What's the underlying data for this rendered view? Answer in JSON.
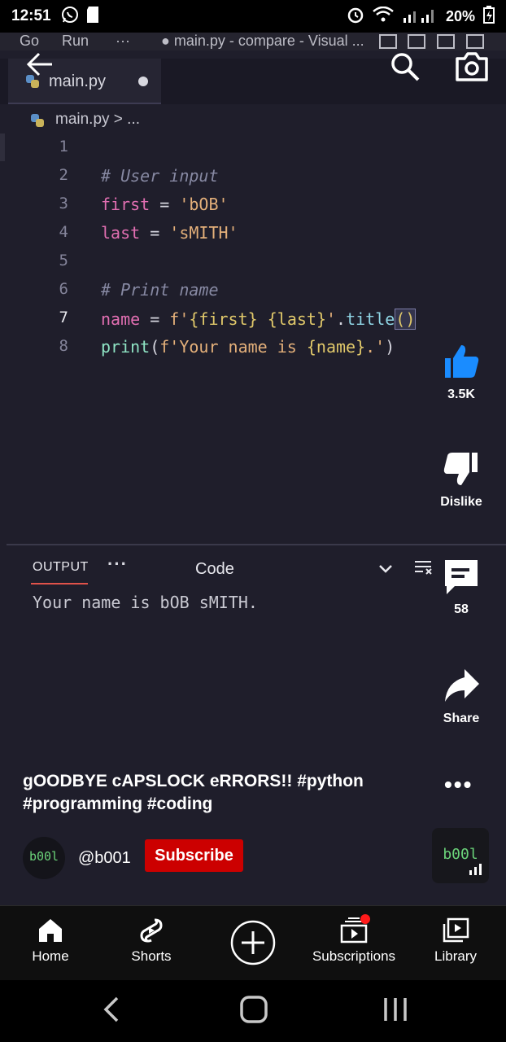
{
  "status_bar": {
    "time": "12:51",
    "battery": "20%",
    "icons": [
      "whatsapp-icon",
      "sd-card-icon",
      "alarm-icon",
      "wifi-icon",
      "signal-icon",
      "battery-icon"
    ]
  },
  "editor": {
    "menu": [
      "Go",
      "Run",
      "···"
    ],
    "window_title": "● main.py - compare - Visual ...",
    "tab_label": "main.py",
    "breadcrumb": "main.py > ...",
    "lines": [
      {
        "n": "1"
      },
      {
        "n": "2"
      },
      {
        "n": "3"
      },
      {
        "n": "4"
      },
      {
        "n": "5"
      },
      {
        "n": "6"
      },
      {
        "n": "7"
      },
      {
        "n": "8"
      }
    ],
    "code": {
      "l2_comment": "# User input",
      "l3_var": "first",
      "l3_eq": " = ",
      "l3_str": "'bOB'",
      "l4_var": "last",
      "l4_eq": " = ",
      "l4_str": "'sMITH'",
      "l6_comment": "# Print name",
      "l7_var": "name",
      "l7_eq": " = ",
      "l7_f": "f'",
      "l7_b1": "{first}",
      "l7_sp": " ",
      "l7_b2": "{last}",
      "l7_q": "'",
      "l7_dot": ".",
      "l7_fn": "title",
      "l7_paren": "()",
      "l8_fn": "print",
      "l8_open": "(",
      "l8_f": "f'Your name is ",
      "l8_b": "{name}",
      "l8_end": ".'",
      "l8_close": ")"
    },
    "panel": {
      "tab": "OUTPUT",
      "dots": "···",
      "selected_channel": "Code",
      "output_text": "Your name is bOB sMITH."
    }
  },
  "shorts": {
    "likes": "3.5K",
    "dislike_label": "Dislike",
    "comments": "58",
    "share_label": "Share",
    "caption": "gOODBYE cAPSLOCK eRRORS!! #python #programming #coding",
    "channel_handle": "@b001",
    "avatar_text": "b00l",
    "thumb_text": "b00l",
    "subscribe_label": "Subscribe"
  },
  "bottom_nav": {
    "items": [
      {
        "label": "Home",
        "icon": "home-icon"
      },
      {
        "label": "Shorts",
        "icon": "shorts-icon"
      },
      {
        "label": "",
        "icon": "create-icon"
      },
      {
        "label": "Subscriptions",
        "icon": "subscriptions-icon"
      },
      {
        "label": "Library",
        "icon": "library-icon"
      }
    ]
  },
  "colors": {
    "editor_bg": "#1f1e2b",
    "subscribe_red": "#cc0000",
    "output_underline": "#e0524a"
  }
}
